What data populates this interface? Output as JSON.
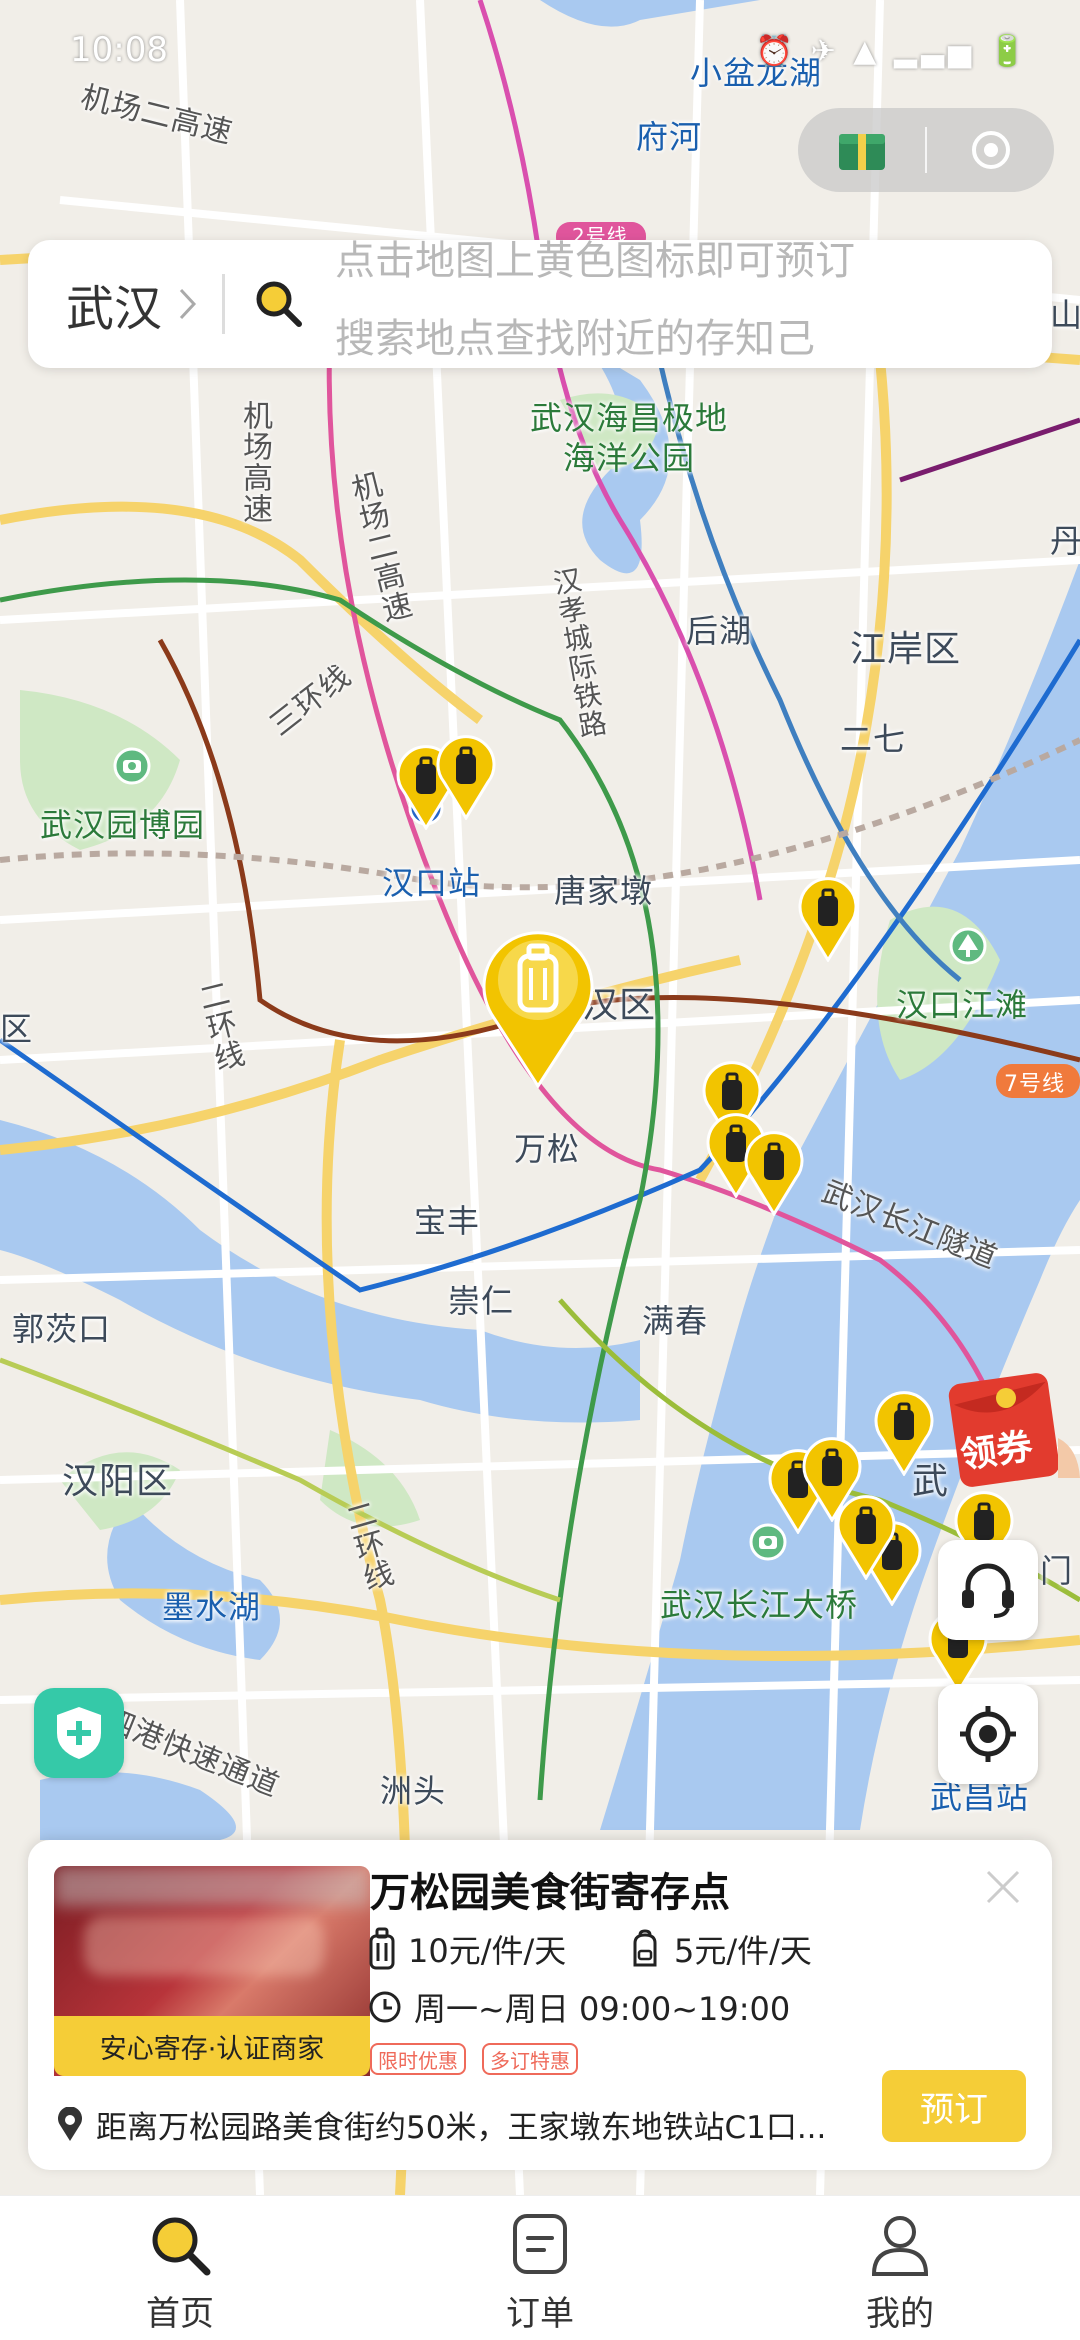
{
  "status_bar": {
    "time": "10:08",
    "icons": "⏰ ✈ ▲ ▂▃▅ 🔋"
  },
  "search": {
    "city": "武汉",
    "hint_line1": "点击地图上黄色图标即可预订",
    "hint_line2": "搜索地点查找附近的存知己"
  },
  "map_labels": {
    "xiaopenglong_lake": "小盆龙湖",
    "fuhe": "府河",
    "line2_badge": "2号线",
    "airport_expressway2_top": "机场二高速",
    "haichang_park": "武汉海昌极地\n海洋公园",
    "airport_expressway_vertical": "机场高速",
    "airport_expressway2_mid": "机场二高速",
    "hanxiao_railway": "汉孝城际铁路",
    "houhu": "后湖",
    "jiangan_district": "江岸区",
    "erqi": "二七",
    "third_ring": "三环线",
    "garden_expo": "武汉园博园",
    "hankou_station": "汉口站",
    "tangjiadun": "唐家墩",
    "jianghan_district": "汉区",
    "hankou_riverbank": "汉口江滩",
    "second_ring_left": "二环线",
    "line7_badge": "7号线",
    "wansong": "万松",
    "baofeng": "宝丰",
    "yangtze_tunnel": "武汉长江隧道",
    "chongren": "崇仁",
    "manchun": "满春",
    "guojiaying": "郭茨口",
    "hanyang_district": "汉阳区",
    "wuchang_partial": "武",
    "moshui_lake": "墨水湖",
    "second_ring_bottom": "二环线",
    "yangtze_bridge": "武汉长江大桥",
    "men_partial": "门",
    "yangsi_expressway": "杨泗港快速通道",
    "zhoutou": "洲头",
    "wuchang_station": "武昌站",
    "dan_partial": "丹",
    "shan_partial": "山",
    "left_partial": "区"
  },
  "coupon": {
    "label": "领券"
  },
  "store": {
    "name": "万松园美食街寄存点",
    "trust_badge": "安心寄存·认证商家",
    "price_large": "10元/件/天",
    "price_small": "5元/件/天",
    "hours": "周一~周日 09:00~19:00",
    "tags": [
      "限时优惠",
      "多订特惠"
    ],
    "address": "距离万松园路美食街约50米，王家墩东地铁站C1口...",
    "book_label": "预订"
  },
  "nav": {
    "home": "首页",
    "orders": "订单",
    "mine": "我的"
  },
  "colors": {
    "accent": "#f5cd37",
    "marker_yellow": "#f2c400",
    "shield_green": "#35c9a8",
    "tag_red": "#ef6a5a"
  }
}
